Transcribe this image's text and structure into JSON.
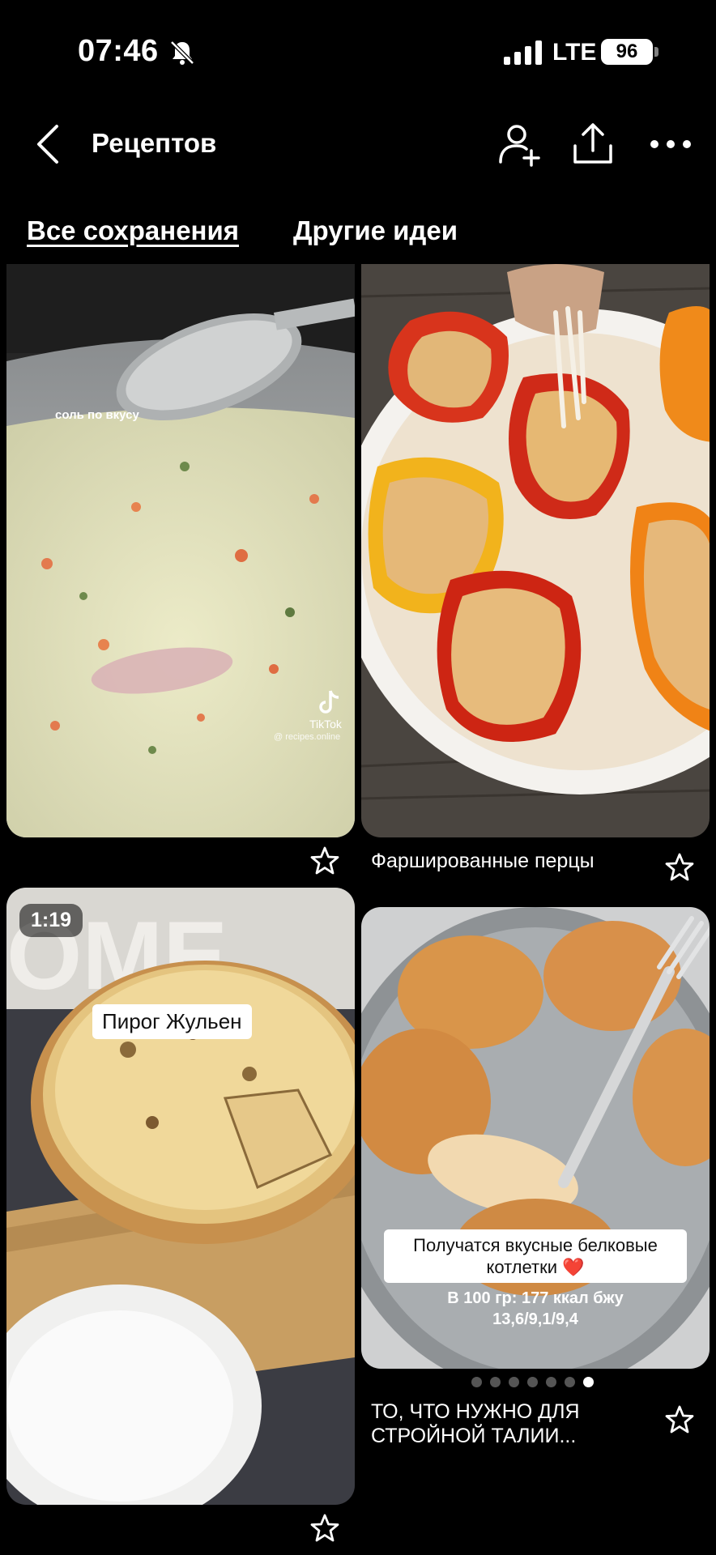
{
  "status_bar": {
    "time": "07:46",
    "network": "LTE",
    "battery": "96"
  },
  "header": {
    "title": "Рецептов"
  },
  "tabs": [
    {
      "label": "Все сохранения",
      "active": true
    },
    {
      "label": "Другие идеи",
      "active": false
    }
  ],
  "pins": [
    {
      "overlay_text": "соль по вкусу",
      "watermark": "TikTok",
      "watermark_handle": "@ recipes.online",
      "title": ""
    },
    {
      "title": "Фаршированные перцы"
    },
    {
      "badge": "1:19",
      "label": "Пирог Жульен",
      "title": ""
    },
    {
      "label_line1": "Получатся вкусные белковые",
      "label_line2": "котлетки ❤️",
      "caption_line1": "В 100 гр: 177 ккал бжу",
      "caption_line2": "13,6/9,1/9,4",
      "title": "ТО, ЧТО НУЖНО ДЛЯ СТРОЙНОЙ ТАЛИИ...",
      "carousel_pages": 7,
      "carousel_active": 7
    }
  ],
  "icons": [
    "bell-slash-icon",
    "signal-icon",
    "back-chevron-icon",
    "add-person-icon",
    "share-icon",
    "more-icon",
    "star-icon",
    "tiktok-icon"
  ]
}
